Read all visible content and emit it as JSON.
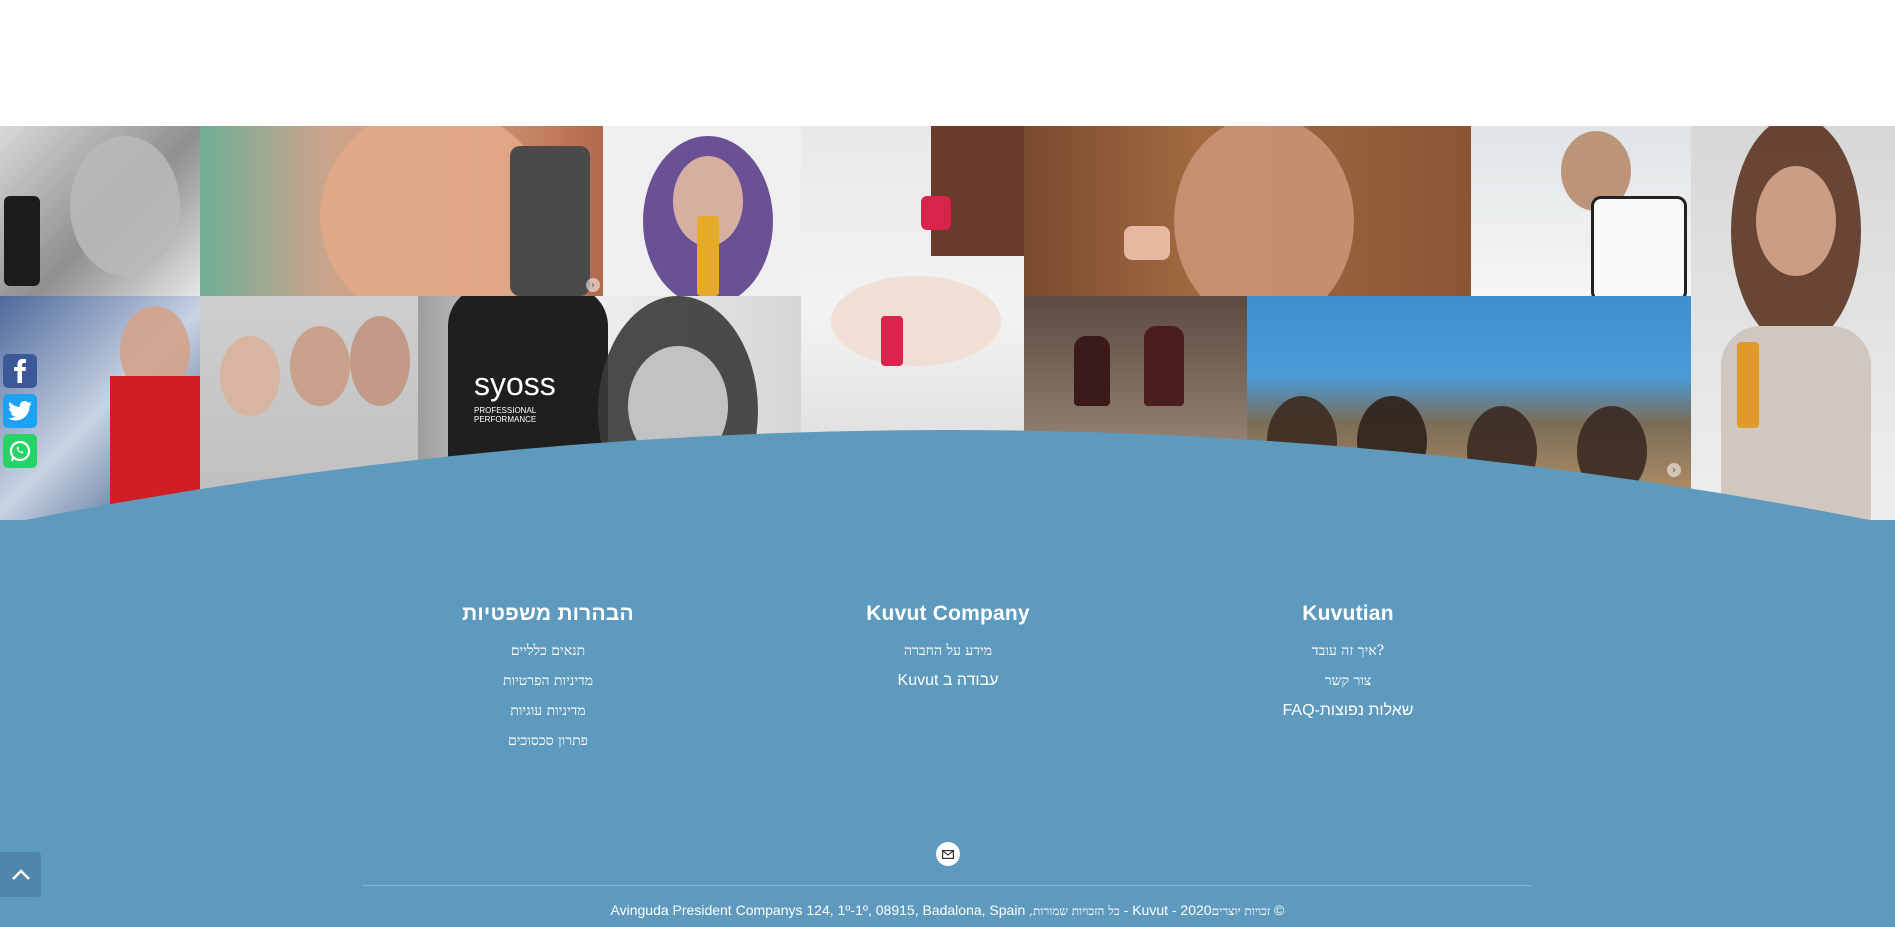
{
  "gallery": {
    "photos": [
      "syoss-shampoo-woman-photo",
      "redhead-woman-photo",
      "purple-hair-woman-photo",
      "woman-in-bed-photo",
      "woman-applying-cream-photo",
      "man-in-apron-photo",
      "woman-with-oil-photo",
      "woman-with-snacks-photo",
      "family-on-floor-photo",
      "syoss-bottle-photo",
      "wine-glasses-photo",
      "beach-drinks-photo"
    ],
    "product_label": "syoss",
    "product_sublabel": "PROFESSIONAL PERFORMANCE"
  },
  "social": {
    "facebook_icon": "facebook-icon",
    "twitter_icon": "twitter-icon",
    "whatsapp_icon": "whatsapp-icon"
  },
  "footer": {
    "columns": [
      {
        "title": "הבהרות משפטיות",
        "links": [
          "תנאים כלליים",
          "מדיניות הפרטיות",
          "מדיניות עוגיות",
          "פתרון סכסוכים"
        ]
      },
      {
        "title": "Kuvut Company",
        "links": [
          "מידע על החברה",
          "עבודה ב Kuvut"
        ]
      },
      {
        "title": "Kuvutian",
        "links": [
          "?איך זה עובד",
          "צור קשר",
          "שאלות נפוצות-FAQ"
        ]
      }
    ],
    "address": "Avinguda President Companys 124, 1º-1º, 08915, Badalona, Spain",
    "rights_text": ",כל הזכויות שמורות",
    "brand_year": "- Kuvut - 2020",
    "copyright_text": "זכויות יוצרים",
    "copyright_symbol": "©"
  },
  "colors": {
    "footer_bg": "#5e9abe",
    "facebook": "#3b5998",
    "twitter": "#1da1f2",
    "whatsapp": "#25d366"
  }
}
